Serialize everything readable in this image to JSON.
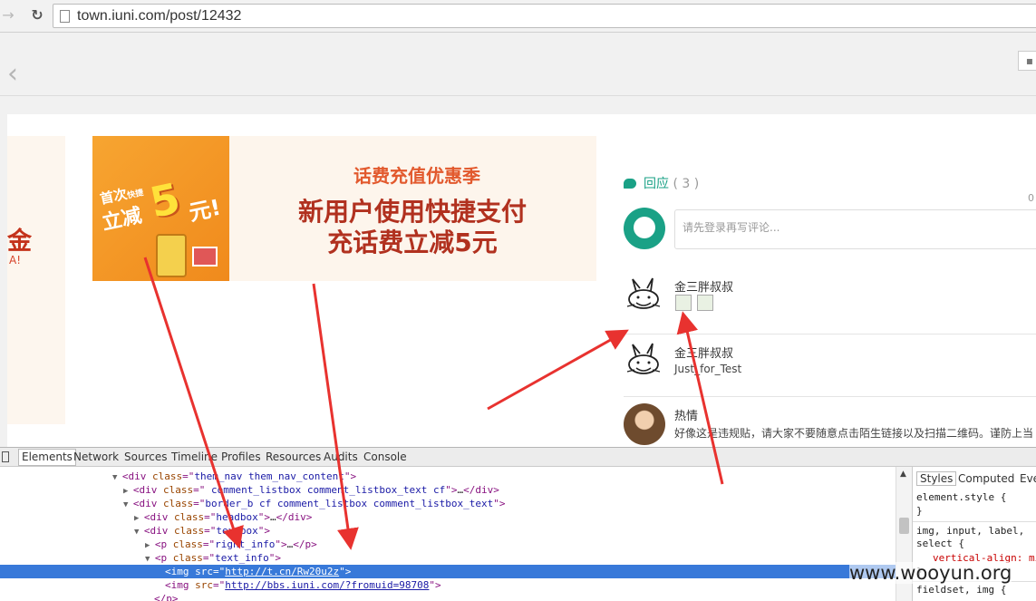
{
  "browser": {
    "url": "town.iuni.com/post/12432"
  },
  "left_banner": {
    "big_text": "金",
    "small_text": "A!"
  },
  "ad": {
    "image_line1": "首次",
    "image_line1b": "快捷",
    "image_line2": "立减",
    "image_big": "5",
    "image_yuan": "元!",
    "tag": "话费充值优惠季",
    "line_a": "新用户使用快捷支付",
    "line_b": "充话费立减5元"
  },
  "comments": {
    "header_label": "回应",
    "header_count": "( 3 )",
    "zero_corner": "0",
    "input_placeholder": "请先登录再写评论...",
    "items": [
      {
        "name": "金三胖叔叔",
        "text": ""
      },
      {
        "name": "金三胖叔叔",
        "text": "Just_for_Test"
      },
      {
        "name": "热情",
        "text": "好像这是违规贴，请大家不要随意点击陌生链接以及扫描二维码。谨防上当"
      }
    ]
  },
  "devtools": {
    "tabs": [
      "Elements",
      "Network",
      "Sources",
      "Timeline",
      "Profiles",
      "Resources",
      "Audits",
      "Console"
    ],
    "active_tab": "Elements",
    "dom_lines": [
      {
        "tw": "▼",
        "parts": [
          [
            "tag",
            "<div "
          ],
          [
            "attr",
            "class"
          ],
          [
            "tag",
            "=\""
          ],
          [
            "val",
            "them_nav them_nav_content"
          ],
          [
            "tag",
            "\">"
          ]
        ]
      },
      {
        "tw": "▶",
        "parts": [
          [
            "tag",
            "<div "
          ],
          [
            "attr",
            "class"
          ],
          [
            "tag",
            "=\""
          ],
          [
            "val",
            " comment_listbox comment_listbox_text cf"
          ],
          [
            "tag",
            "\">"
          ],
          [
            "txt",
            "…"
          ],
          [
            "tag",
            "</div>"
          ]
        ]
      },
      {
        "tw": "▼",
        "parts": [
          [
            "tag",
            "<div "
          ],
          [
            "attr",
            "class"
          ],
          [
            "tag",
            "=\""
          ],
          [
            "val",
            "border_b cf comment_listbox comment_listbox_text"
          ],
          [
            "tag",
            "\">"
          ]
        ]
      },
      {
        "tw": "▶",
        "parts": [
          [
            "tag",
            "<div "
          ],
          [
            "attr",
            "class"
          ],
          [
            "tag",
            "=\""
          ],
          [
            "val",
            "headbox"
          ],
          [
            "tag",
            "\">"
          ],
          [
            "txt",
            "…"
          ],
          [
            "tag",
            "</div>"
          ]
        ]
      },
      {
        "tw": "▼",
        "parts": [
          [
            "tag",
            "<div "
          ],
          [
            "attr",
            "class"
          ],
          [
            "tag",
            "=\""
          ],
          [
            "val",
            "textbox"
          ],
          [
            "tag",
            "\">"
          ]
        ]
      },
      {
        "tw": "▶",
        "parts": [
          [
            "tag",
            "<p "
          ],
          [
            "attr",
            "class"
          ],
          [
            "tag",
            "=\""
          ],
          [
            "val",
            "right_info"
          ],
          [
            "tag",
            "\">"
          ],
          [
            "txt",
            "…"
          ],
          [
            "tag",
            "</p>"
          ]
        ]
      },
      {
        "tw": "▼",
        "parts": [
          [
            "tag",
            "<p "
          ],
          [
            "attr",
            "class"
          ],
          [
            "tag",
            "=\""
          ],
          [
            "val",
            "text_info"
          ],
          [
            "tag",
            "\">"
          ]
        ]
      },
      {
        "tw": "",
        "parts": [
          [
            "tag",
            "<img "
          ],
          [
            "attr",
            "src"
          ],
          [
            "tag",
            "=\""
          ],
          [
            "lnk",
            "http://t.cn/Rw20u2z"
          ],
          [
            "tag",
            "\">"
          ]
        ]
      },
      {
        "tw": "",
        "parts": [
          [
            "tag",
            "<img "
          ],
          [
            "attr",
            "src"
          ],
          [
            "tag",
            "=\""
          ],
          [
            "lnk",
            "http://bbs.iuni.com/?fromuid=98708"
          ],
          [
            "tag",
            "\">"
          ]
        ]
      },
      {
        "tw": "",
        "parts": [
          [
            "tag",
            "</p>"
          ]
        ]
      }
    ],
    "styles_tabs": [
      "Styles",
      "Computed",
      "Eve"
    ],
    "styles_lines": [
      "element.style {",
      "}",
      "img, input, label,",
      "select {",
      "vertical-align: mi",
      "}",
      "fieldset, img {"
    ],
    "styles_prop": "vertical-align: mi"
  },
  "watermark": "www.wooyun.org"
}
